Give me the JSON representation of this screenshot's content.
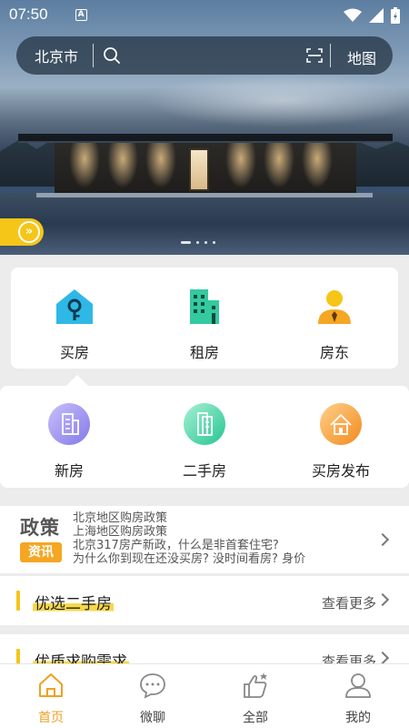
{
  "status_bar": {
    "time": "07:50",
    "notif_badge": "A"
  },
  "search": {
    "city": "北京市",
    "map_label": "地图"
  },
  "menu_primary": [
    {
      "label": "买房",
      "icon": "key-house-icon",
      "color": "#2fb8e6"
    },
    {
      "label": "租房",
      "icon": "building-icon",
      "color": "#35c9a0"
    },
    {
      "label": "房东",
      "icon": "landlord-icon",
      "color": "#f5a623"
    }
  ],
  "menu_secondary": [
    {
      "label": "新房",
      "icon": "new-house-icon",
      "color": "#9b8ff0"
    },
    {
      "label": "二手房",
      "icon": "second-hand-house-icon",
      "color": "#43d3a4"
    },
    {
      "label": "买房发布",
      "icon": "publish-house-icon",
      "color": "#f7a23a"
    }
  ],
  "news": {
    "title": "政策",
    "badge": "资讯",
    "lines": [
      "北京地区购房政策",
      "上海地区购房政策",
      "北京317房产新政，什么是非首套住宅?",
      "为什么你到现在还没买房? 没时间看房? 身价"
    ]
  },
  "sections": [
    {
      "title": "优选二手房",
      "more": "查看更多"
    },
    {
      "title": "优质求购需求",
      "more": "查看更多"
    }
  ],
  "bottom_nav": [
    {
      "label": "首页",
      "icon": "home-icon",
      "active": true
    },
    {
      "label": "微聊",
      "icon": "chat-bubble-icon",
      "active": false
    },
    {
      "label": "全部",
      "icon": "thumbs-up-star-icon",
      "active": false
    },
    {
      "label": "我的",
      "icon": "user-icon",
      "active": false
    }
  ],
  "colors": {
    "accent": "#f5c518",
    "active_tab": "#f0a020"
  }
}
